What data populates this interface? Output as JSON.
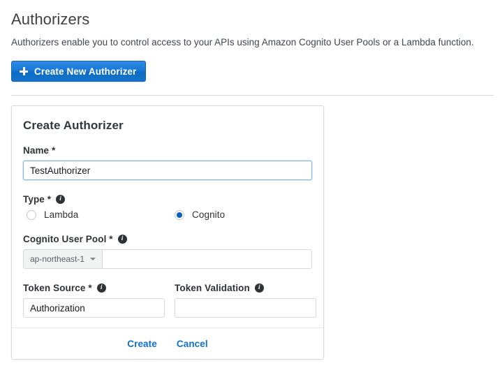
{
  "page": {
    "title": "Authorizers",
    "subtitle": "Authorizers enable you to control access to your APIs using Amazon Cognito User Pools or a Lambda function.",
    "create_new_button": "Create New Authorizer",
    "plus_icon": "plus-icon"
  },
  "card": {
    "title": "Create Authorizer",
    "name": {
      "label": "Name *",
      "value": "TestAuthorizer",
      "placeholder": ""
    },
    "type": {
      "label": "Type *",
      "info_icon": "info-icon",
      "options": [
        {
          "label": "Lambda",
          "selected": false
        },
        {
          "label": "Cognito",
          "selected": true
        }
      ]
    },
    "cognito_user_pool": {
      "label": "Cognito User Pool *",
      "info_icon": "info-icon",
      "region": "ap-northeast-1",
      "caret_icon": "chevron-down-icon",
      "value": "",
      "placeholder": ""
    },
    "token_source": {
      "label": "Token Source *",
      "info_icon": "info-icon",
      "value": "Authorization",
      "placeholder": ""
    },
    "token_validation": {
      "label": "Token Validation",
      "info_icon": "info-icon",
      "value": "",
      "placeholder": ""
    },
    "footer": {
      "create": "Create",
      "cancel": "Cancel"
    }
  },
  "colors": {
    "primary_blue": "#1678d4",
    "link_blue": "#0f6fcf",
    "radio_selected": "#0a5fc2",
    "border_gray": "#d5d9dc",
    "divider_gray": "#d5dbdb"
  },
  "info_glyph": "i"
}
